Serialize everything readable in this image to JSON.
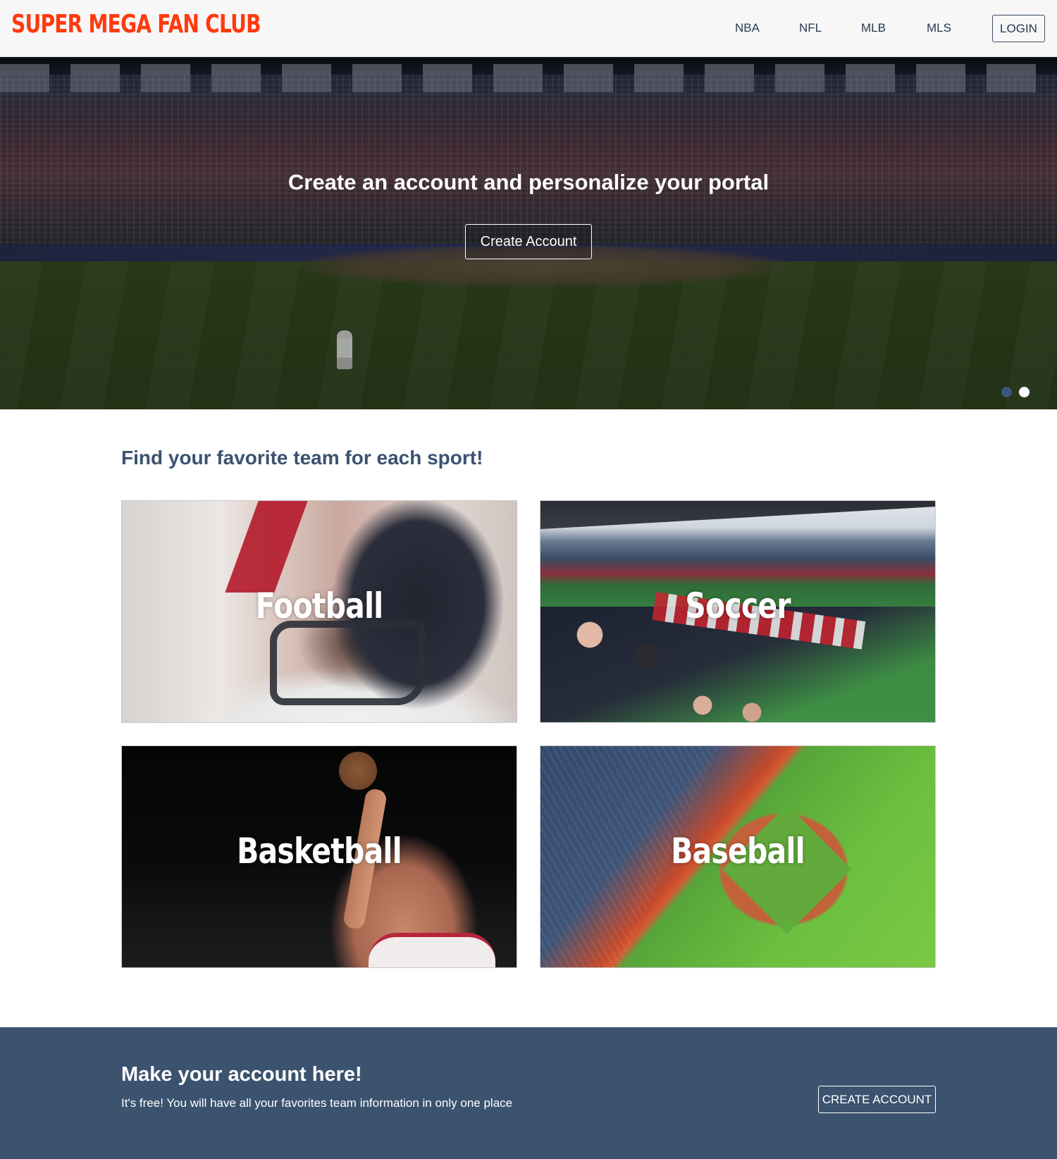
{
  "header": {
    "logo": "SUPER MEGA FAN CLUB",
    "nav": [
      {
        "label": "NBA"
      },
      {
        "label": "NFL"
      },
      {
        "label": "MLB"
      },
      {
        "label": "MLS"
      }
    ],
    "login_label": "LOGIN"
  },
  "hero": {
    "title": "Create an account and personalize your portal",
    "cta_label": "Create Account",
    "slides_total": 2,
    "active_slide": 2
  },
  "sports": {
    "heading": "Find your favorite team for each sport!",
    "cards": [
      {
        "label": "Football"
      },
      {
        "label": "Soccer"
      },
      {
        "label": "Basketball"
      },
      {
        "label": "Baseball"
      }
    ]
  },
  "footer": {
    "title": "Make your account here!",
    "text": "It's free! You will have all your favorites team information in only one place",
    "button_label": "CREATE ACCOUNT"
  },
  "colors": {
    "brand": "#ff3a0e",
    "navy": "#3b536f",
    "heading": "#3b5271"
  }
}
